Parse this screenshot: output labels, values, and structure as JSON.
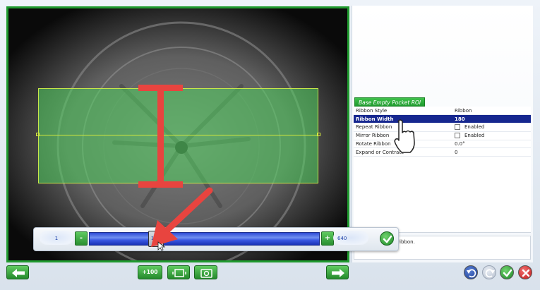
{
  "roi_panel": {
    "tab_label": "Base Empty Pocket ROI",
    "properties": [
      {
        "name": "Ribbon Style",
        "value": "Ribbon"
      },
      {
        "name": "Ribbon Width",
        "value": "180"
      },
      {
        "name": "Repeat Ribbon",
        "value": "Enabled"
      },
      {
        "name": "Mirror Ribbon",
        "value": "Enabled"
      },
      {
        "name": "Rotate Ribbon",
        "value": "0.0°"
      },
      {
        "name": "Expand or Contract",
        "value": "0"
      }
    ],
    "help_text": "he width of the ribbon."
  },
  "slider": {
    "min_label": "1",
    "max_label": "640",
    "value_label": "180",
    "minus_label": "-",
    "plus_label": "+",
    "value_fraction": 0.28
  },
  "toolbar": {
    "plus100_label": "+100"
  },
  "icons": {
    "prev": "arrow-left-icon",
    "next": "arrow-right-icon",
    "roi": "roi-frame-icon",
    "snapshot": "camera-icon",
    "undo": "undo-icon",
    "redo": "redo-icon",
    "ok": "checkmark-icon",
    "cancel": "close-icon",
    "cursor": "hand-pointer-icon"
  },
  "colors": {
    "accent_green": "#1f9a2e",
    "selected_row": "#16278f",
    "roi_overlay": "#5fd36a",
    "annotation_red": "#e8443f"
  }
}
